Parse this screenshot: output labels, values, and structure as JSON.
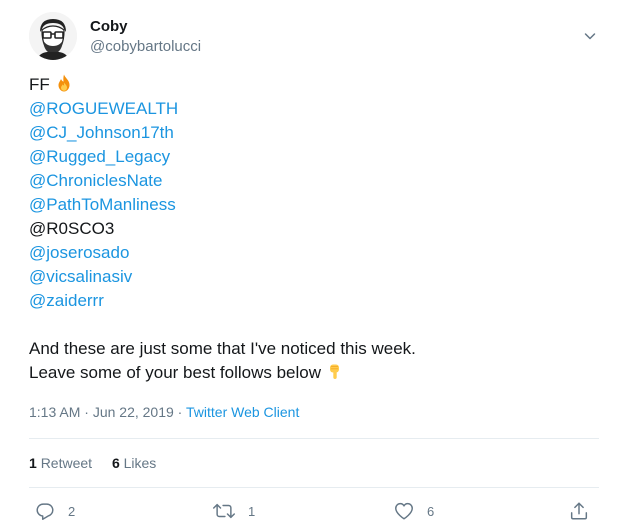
{
  "author": {
    "display_name": "Coby",
    "handle": "@cobybartolucci"
  },
  "body": {
    "lines": [
      {
        "text": "FF",
        "kind": "plain",
        "emoji": "fire"
      },
      {
        "text": "@ROGUEWEALTH",
        "kind": "mention"
      },
      {
        "text": "@CJ_Johnson17th",
        "kind": "mention"
      },
      {
        "text": "@Rugged_Legacy",
        "kind": "mention"
      },
      {
        "text": "@ChroniclesNate",
        "kind": "mention"
      },
      {
        "text": "@PathToManliness",
        "kind": "mention"
      },
      {
        "text": "@R0SCO3",
        "kind": "plain"
      },
      {
        "text": "@joserosado",
        "kind": "mention"
      },
      {
        "text": "@vicsalinasiv",
        "kind": "mention"
      },
      {
        "text": "@zaiderrr",
        "kind": "mention"
      },
      {
        "text": "",
        "kind": "spacer"
      },
      {
        "text": "And these are just some that I've noticed this week.",
        "kind": "plain"
      },
      {
        "text": "Leave some of your best follows below",
        "kind": "plain",
        "emoji": "point-down"
      }
    ]
  },
  "meta": {
    "time": "1:13 AM",
    "separator": " · ",
    "date": "Jun 22, 2019",
    "source": "Twitter Web Client"
  },
  "stats": {
    "retweets_count": "1",
    "retweets_label": "Retweet",
    "likes_count": "6",
    "likes_label": "Likes"
  },
  "actions": {
    "reply_count": "2",
    "retweet_count": "1",
    "like_count": "6"
  },
  "colors": {
    "link": "#1b95e0",
    "secondary_text": "#657786",
    "divider": "#e6ecf0"
  }
}
